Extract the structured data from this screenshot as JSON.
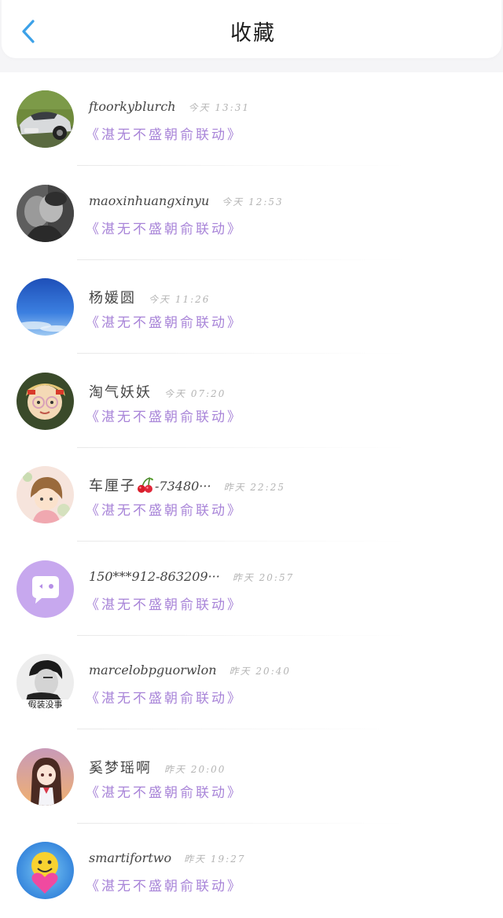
{
  "header": {
    "title": "收藏",
    "back_icon": "chevron-left-icon",
    "accent_color": "#3ca1e8"
  },
  "accent_colors": {
    "work_title": "#a884d8",
    "time": "#b4b4b4"
  },
  "items": [
    {
      "name": "ftoorkyblurch",
      "time": "今天 13:31",
      "work": "《湛无不盛朝俞联动》",
      "avatar": "car-photo-avatar"
    },
    {
      "name": "maoxinhuangxinyu",
      "time": "今天 12:53",
      "work": "《湛无不盛朝俞联动》",
      "avatar": "bw-couple-avatar"
    },
    {
      "name": "杨媛圆",
      "time": "今天 11:26",
      "work": "《湛无不盛朝俞联动》",
      "avatar": "blue-sky-avatar"
    },
    {
      "name": "淘气妖妖",
      "time": "今天 07:20",
      "work": "《湛无不盛朝俞联动》",
      "avatar": "cartoon-girl-avatar"
    },
    {
      "name": "车厘子",
      "name_suffix": "-73480···",
      "time": "昨天 22:25",
      "work": "《湛无不盛朝俞联动》",
      "avatar": "anime-girl-avatar"
    },
    {
      "name": "150***912-863209···",
      "time": "昨天 20:57",
      "work": "《湛无不盛朝俞联动》",
      "avatar": "default-purple-avatar"
    },
    {
      "name": "marcelobpguorwlon",
      "time": "昨天 20:40",
      "work": "《湛无不盛朝俞联动》",
      "avatar": "bw-boy-avatar",
      "avatar_caption": "假装没事"
    },
    {
      "name": "奚梦瑶啊",
      "time": "昨天 20:00",
      "work": "《湛无不盛朝俞联动》",
      "avatar": "anime-schoolgirl-avatar"
    },
    {
      "name": "smartifortwo",
      "time": "昨天 19:27",
      "work": "《湛无不盛朝俞联动》",
      "avatar": "smiley-heart-avatar"
    }
  ]
}
